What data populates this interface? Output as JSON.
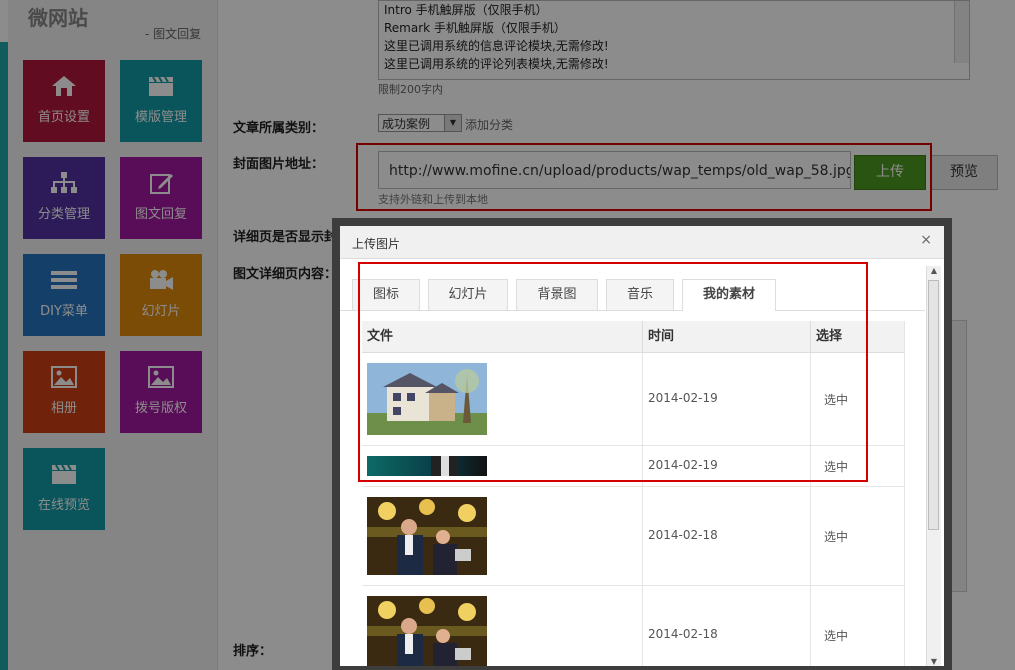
{
  "sidebar": {
    "brand": "微网站",
    "subtitle": "- 图文回复",
    "tiles": [
      {
        "label": "首页设置",
        "icon": "home-icon",
        "color": "#b3173c"
      },
      {
        "label": "模版管理",
        "icon": "clapper-icon",
        "color": "#119ba6"
      },
      {
        "label": "分类管理",
        "icon": "sitemap-icon",
        "color": "#5132a0"
      },
      {
        "label": "图文回复",
        "icon": "edit-icon",
        "color": "#a3169f"
      },
      {
        "label": "DIY菜单",
        "icon": "list-icon",
        "color": "#2674bf"
      },
      {
        "label": "幻灯片",
        "icon": "camera-icon",
        "color": "#e08a0a"
      },
      {
        "label": "相册",
        "icon": "picture-icon",
        "color": "#cc3e15"
      },
      {
        "label": "拨号版权",
        "icon": "picture-icon",
        "color": "#a3169f"
      },
      {
        "label": "在线预览",
        "icon": "clapper-icon",
        "color": "#119ba6"
      }
    ]
  },
  "form": {
    "textarea_lines": [
      "Intro 手机触屏版（仅限手机）",
      "Remark    手机触屏版（仅限手机）",
      "这里已调用系统的信息评论模块,无需修改!",
      "这里已调用系统的评论列表模块,无需修改!"
    ],
    "limit_text": "限制200字内",
    "category_label": "文章所属类别：",
    "category_value": "成功案例",
    "add_category": "添加分类",
    "cover_label": "封面图片地址：",
    "cover_url": "http://www.mofine.cn/upload/products/wap_temps/old_wap_58.jpg",
    "upload_button": "上传",
    "preview_button": "预览",
    "support_text": "支持外链和上传到本地",
    "detail_show_label": "详细页是否显示封",
    "detail_content_label": "图文详细页内容：",
    "sort_label": "排序："
  },
  "modal": {
    "title": "上传图片",
    "close": "×",
    "tabs": [
      "图标",
      "幻灯片",
      "背景图",
      "音乐",
      "我的素材"
    ],
    "active_tab": "我的素材",
    "columns": [
      "文件",
      "时间",
      "选择"
    ],
    "rows": [
      {
        "thumb": "villa-photo",
        "date": "2014-02-19",
        "action": "选中"
      },
      {
        "thumb": "banner-photo",
        "date": "2014-02-19",
        "action": "选中"
      },
      {
        "thumb": "restaurant-photo",
        "date": "2014-02-18",
        "action": "选中"
      },
      {
        "thumb": "restaurant-photo",
        "date": "2014-02-18",
        "action": "选中"
      }
    ]
  },
  "colors": {
    "highlight": "#d40000",
    "upload_green": "#4e9a1f"
  }
}
